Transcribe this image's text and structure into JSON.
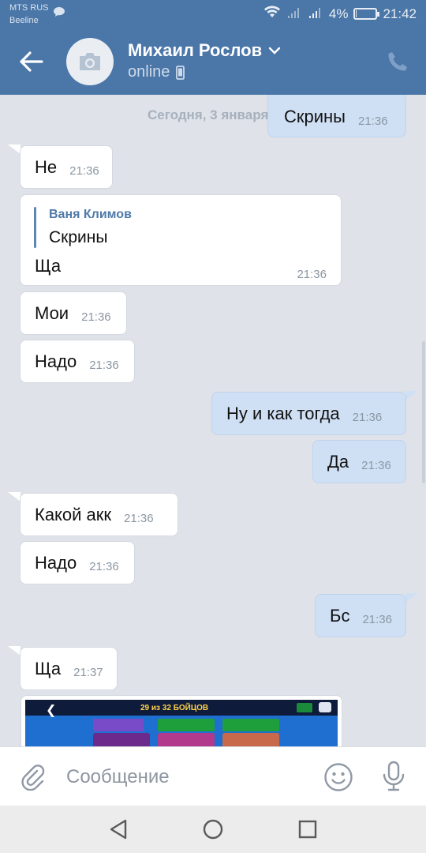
{
  "status_bar": {
    "carrier_primary": "MTS RUS",
    "carrier_secondary": "Beeline",
    "battery_percent": "4%",
    "time": "21:42",
    "battery_level": 0.04
  },
  "header": {
    "contact_name": "Михаил Рослов",
    "presence": "online",
    "icons": [
      "back-arrow-icon",
      "camera-icon",
      "chevron-down-icon",
      "mobile-phone-icon",
      "phone-icon"
    ]
  },
  "chat": {
    "date_separator": "Сегодня, 3 января",
    "messages": [
      {
        "dir": "out",
        "text": "Скрины",
        "time": "21:36"
      },
      {
        "dir": "in",
        "text": "Не",
        "time": "21:36"
      },
      {
        "dir": "in",
        "reply_author": "Ваня Климов",
        "reply_text": "Скрины",
        "text": "Ща",
        "time": "21:36"
      },
      {
        "dir": "in",
        "text": "Мои",
        "time": "21:36"
      },
      {
        "dir": "in",
        "text": "Надо",
        "time": "21:36"
      },
      {
        "dir": "out",
        "text": "Ну и как тогда",
        "time": "21:36"
      },
      {
        "dir": "out",
        "text": "Да",
        "time": "21:36"
      },
      {
        "dir": "in",
        "text": "Какой акк",
        "time": "21:36"
      },
      {
        "dir": "in",
        "text": "Надо",
        "time": "21:36"
      },
      {
        "dir": "out",
        "text": "Бс",
        "time": "21:36"
      },
      {
        "dir": "in",
        "text": "Ща",
        "time": "21:37"
      }
    ],
    "screenshot_caption": "29 из 32 БОЙЦОВ"
  },
  "composer": {
    "placeholder": "Сообщение",
    "icons": [
      "paperclip-icon",
      "smiley-icon",
      "microphone-icon"
    ]
  },
  "colors": {
    "header_bg": "#4a76a8",
    "incoming_bubble": "#ffffff",
    "outgoing_bubble": "#cfe0f5",
    "chat_bg": "#dfe3e9"
  }
}
